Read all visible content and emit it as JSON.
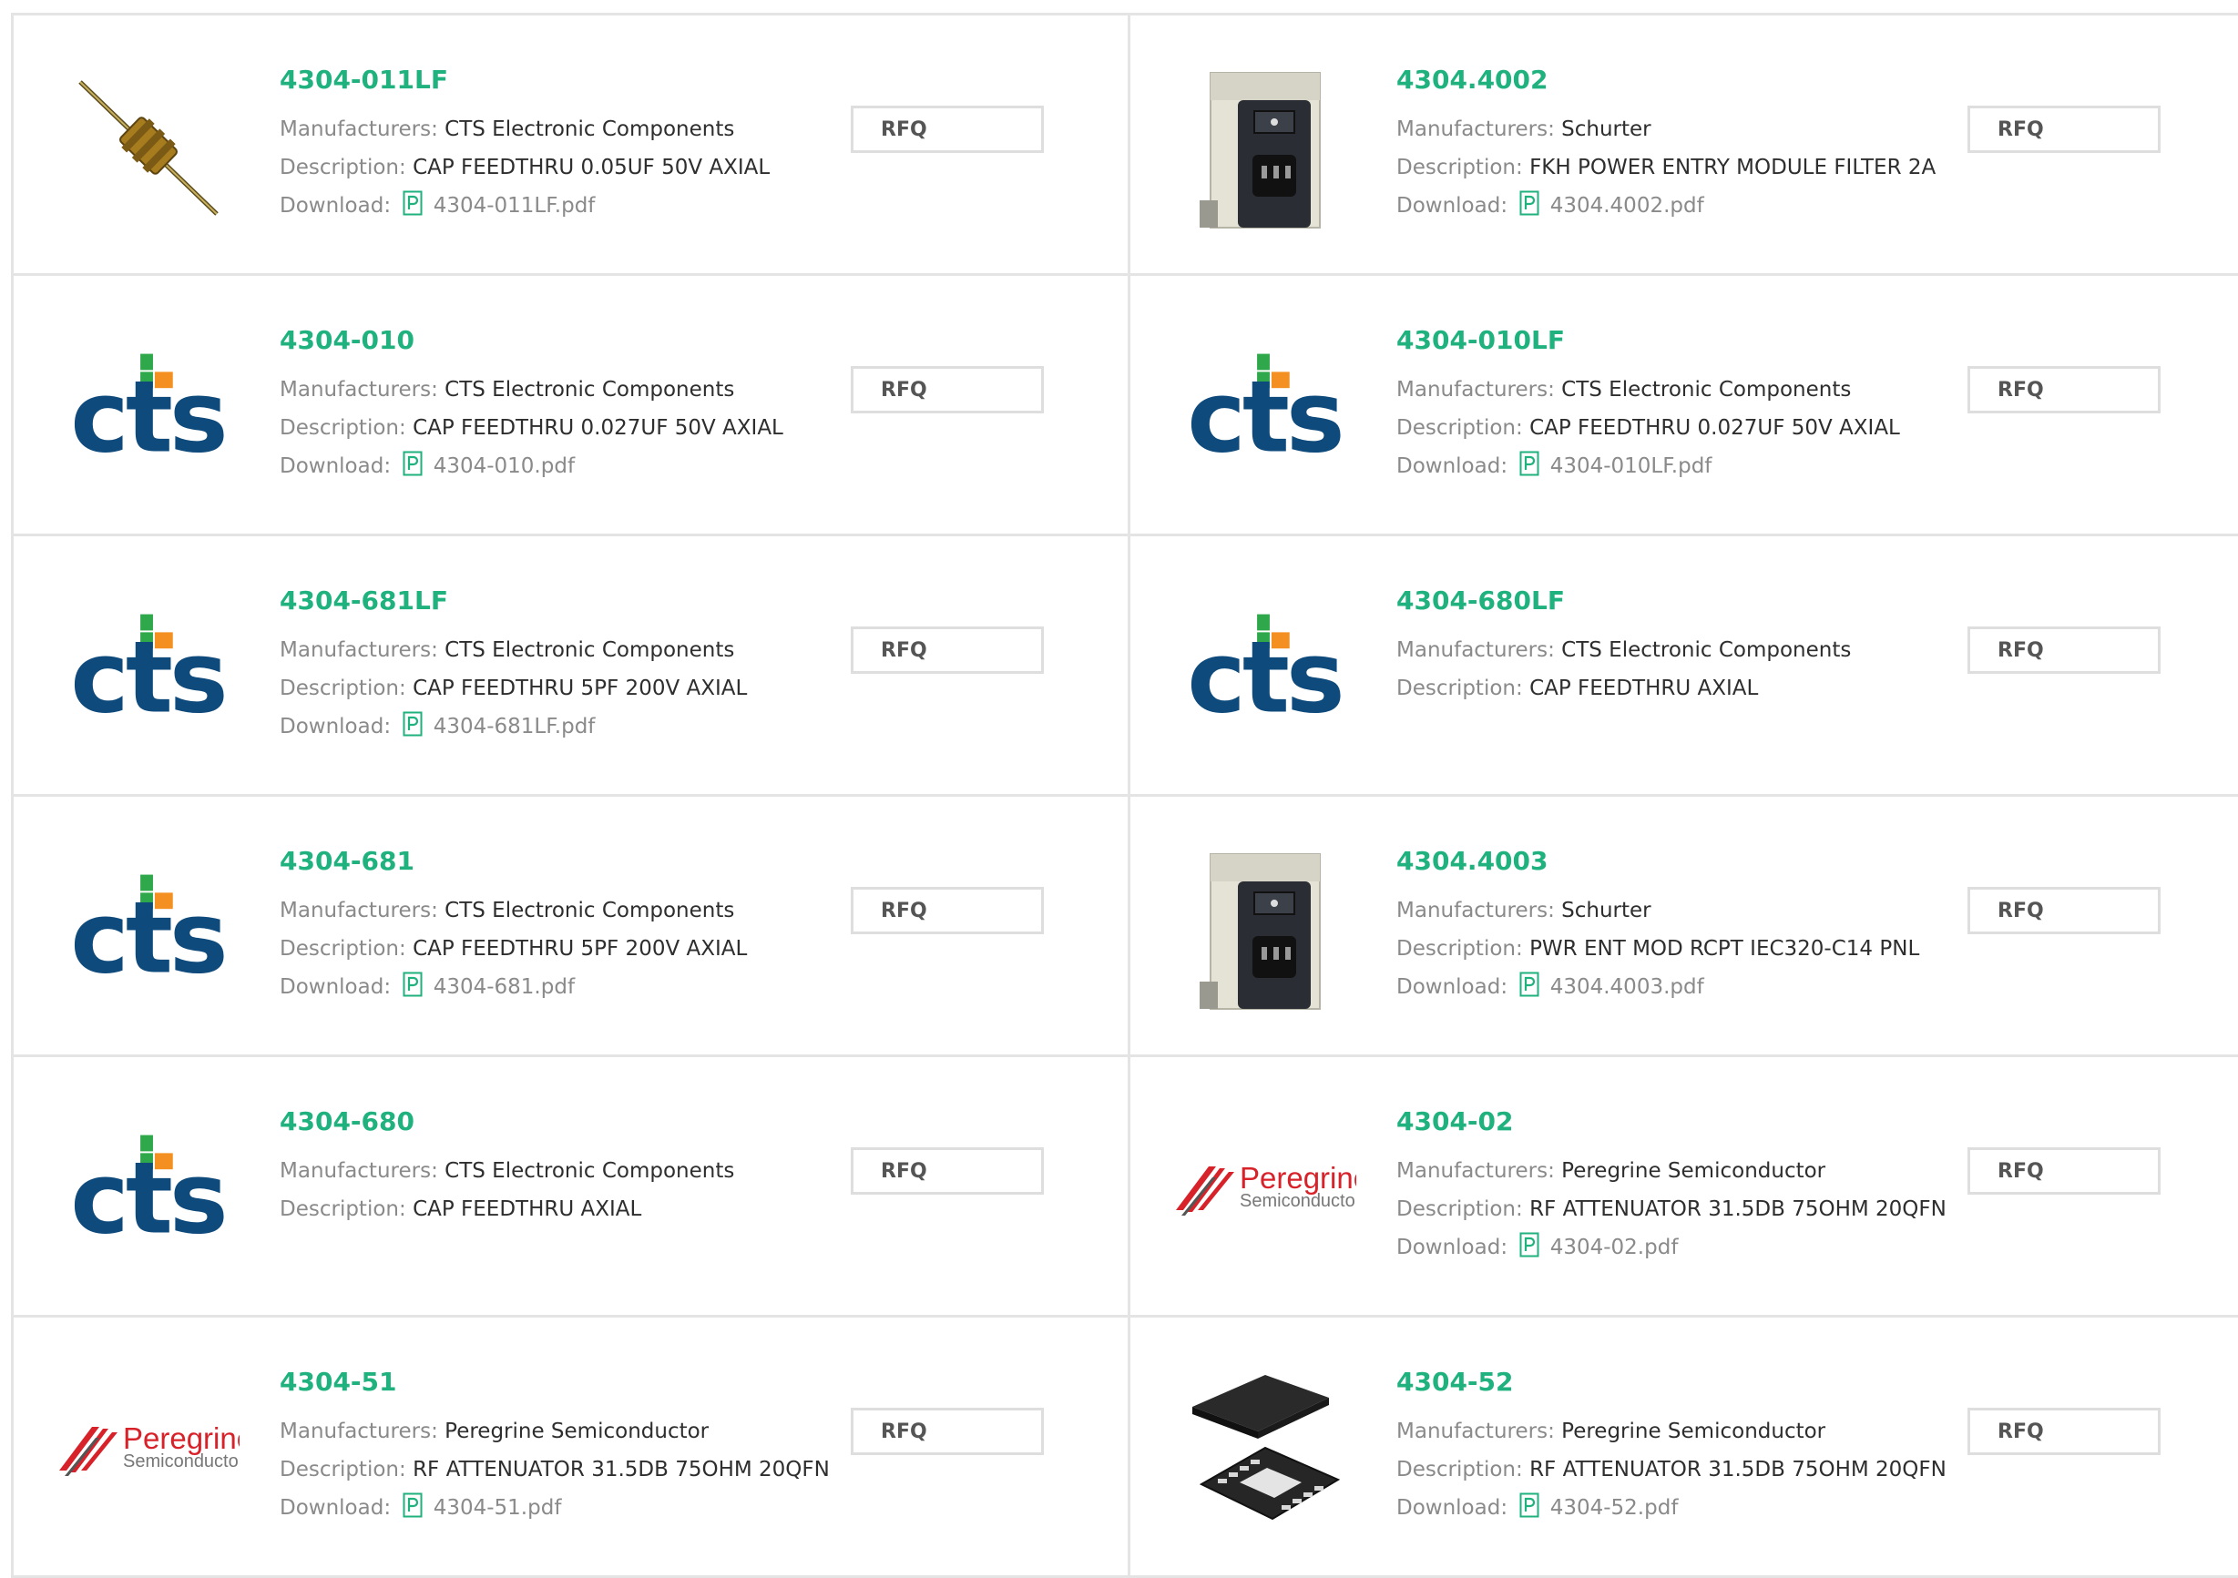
{
  "labels": {
    "manufacturers": "Manufacturers:",
    "description": "Description:",
    "download": "Download:",
    "rfq": "RFQ"
  },
  "colors": {
    "part_number": "#1fb27e",
    "cts_blue": "#0e4a7c",
    "cts_green": "#2ea84a",
    "cts_orange": "#f39021",
    "peregrine_red": "#d8222a"
  },
  "logos": {
    "cts": "cts",
    "peregrine_top": "Peregrine",
    "peregrine_bottom": "Semiconductor"
  },
  "products": [
    {
      "part": "4304-011LF",
      "manufacturer": "CTS Electronic Components",
      "description": "CAP FEEDTHRU 0.05UF 50V AXIAL",
      "download": "4304-011LF.pdf",
      "image": "axial-capacitor-photo"
    },
    {
      "part": "4304.4002",
      "manufacturer": "Schurter",
      "description": "FKH POWER ENTRY MODULE FILTER 2A",
      "download": "4304.4002.pdf",
      "image": "power-entry-module-photo"
    },
    {
      "part": "4304-010",
      "manufacturer": "CTS Electronic Components",
      "description": "CAP FEEDTHRU 0.027UF 50V AXIAL",
      "download": "4304-010.pdf",
      "image": "cts-logo"
    },
    {
      "part": "4304-010LF",
      "manufacturer": "CTS Electronic Components",
      "description": "CAP FEEDTHRU 0.027UF 50V AXIAL",
      "download": "4304-010LF.pdf",
      "image": "cts-logo"
    },
    {
      "part": "4304-681LF",
      "manufacturer": "CTS Electronic Components",
      "description": "CAP FEEDTHRU 5PF 200V AXIAL",
      "download": "4304-681LF.pdf",
      "image": "cts-logo"
    },
    {
      "part": "4304-680LF",
      "manufacturer": "CTS Electronic Components",
      "description": "CAP FEEDTHRU AXIAL",
      "download": null,
      "image": "cts-logo"
    },
    {
      "part": "4304-681",
      "manufacturer": "CTS Electronic Components",
      "description": "CAP FEEDTHRU 5PF 200V AXIAL",
      "download": "4304-681.pdf",
      "image": "cts-logo"
    },
    {
      "part": "4304.4003",
      "manufacturer": "Schurter",
      "description": "PWR ENT MOD RCPT IEC320-C14 PNL",
      "download": "4304.4003.pdf",
      "image": "power-entry-module-photo"
    },
    {
      "part": "4304-680",
      "manufacturer": "CTS Electronic Components",
      "description": "CAP FEEDTHRU AXIAL",
      "download": null,
      "image": "cts-logo"
    },
    {
      "part": "4304-02",
      "manufacturer": "Peregrine Semiconductor",
      "description": "RF ATTENUATOR 31.5DB 75OHM 20QFN",
      "download": "4304-02.pdf",
      "image": "peregrine-logo"
    },
    {
      "part": "4304-51",
      "manufacturer": "Peregrine Semiconductor",
      "description": "RF ATTENUATOR 31.5DB 75OHM 20QFN",
      "download": "4304-51.pdf",
      "image": "peregrine-logo"
    },
    {
      "part": "4304-52",
      "manufacturer": "Peregrine Semiconductor",
      "description": "RF ATTENUATOR 31.5DB 75OHM 20QFN",
      "download": "4304-52.pdf",
      "image": "qfn-chip-photo"
    }
  ]
}
